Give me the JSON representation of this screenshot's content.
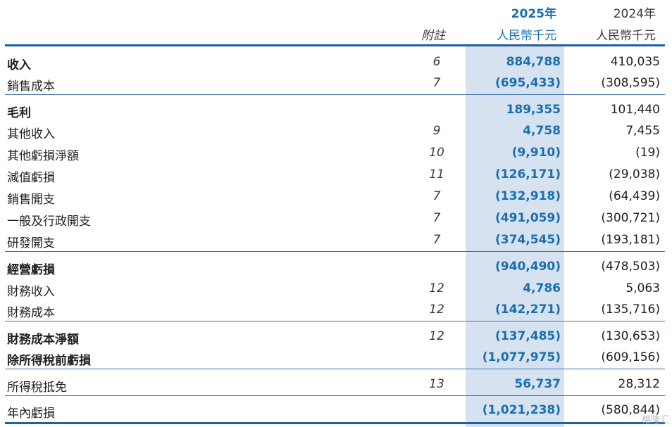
{
  "header": {
    "note_label": "附註",
    "year_current": "2025年",
    "year_prior": "2024年",
    "unit_current": "人民幣千元",
    "unit_prior": "人民幣千元"
  },
  "rows": [
    {
      "label": "收入",
      "note": "6",
      "v2025": "884,788",
      "v2024": "410,035"
    },
    {
      "label": "銷售成本",
      "note": "7",
      "v2025": "(695,433)",
      "v2024": "(308,595)"
    },
    {
      "label": "毛利",
      "note": "",
      "v2025": "189,355",
      "v2024": "101,440"
    },
    {
      "label": "其他收入",
      "note": "9",
      "v2025": "4,758",
      "v2024": "7,455"
    },
    {
      "label": "其他虧損淨額",
      "note": "10",
      "v2025": "(9,910)",
      "v2024": "(19)"
    },
    {
      "label": "減值虧損",
      "note": "11",
      "v2025": "(126,171)",
      "v2024": "(29,038)"
    },
    {
      "label": "銷售開支",
      "note": "7",
      "v2025": "(132,918)",
      "v2024": "(64,439)"
    },
    {
      "label": "一般及行政開支",
      "note": "7",
      "v2025": "(491,059)",
      "v2024": "(300,721)"
    },
    {
      "label": "研發開支",
      "note": "7",
      "v2025": "(374,545)",
      "v2024": "(193,181)"
    },
    {
      "label": "經營虧損",
      "note": "",
      "v2025": "(940,490)",
      "v2024": "(478,503)"
    },
    {
      "label": "財務收入",
      "note": "12",
      "v2025": "4,786",
      "v2024": "5,063"
    },
    {
      "label": "財務成本",
      "note": "12",
      "v2025": "(142,271)",
      "v2024": "(135,716)"
    },
    {
      "label": "財務成本淨額",
      "note": "12",
      "v2025": "(137,485)",
      "v2024": "(130,653)"
    },
    {
      "label": "除所得稅前虧損",
      "note": "",
      "v2025": "(1,077,975)",
      "v2024": "(609,156)"
    },
    {
      "label": "所得稅抵免",
      "note": "13",
      "v2025": "56,737",
      "v2024": "28,312"
    },
    {
      "label": "年內虧損",
      "note": "",
      "v2025": "(1,021,238)",
      "v2024": "(580,844)"
    }
  ],
  "watermark": "格隆汇"
}
